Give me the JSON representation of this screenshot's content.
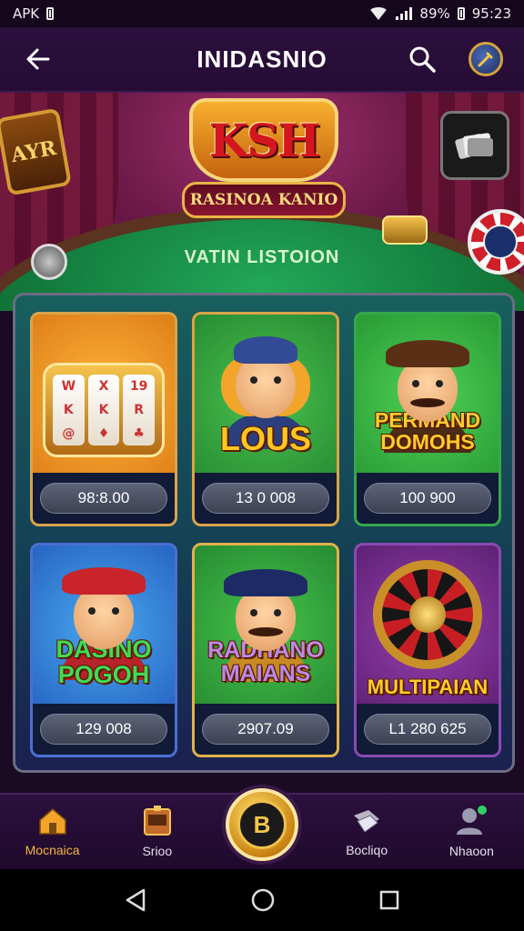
{
  "status_bar": {
    "left_text": "APK",
    "battery_text": "89%",
    "time": "95:23"
  },
  "app_bar": {
    "title": "INIDASNIO",
    "back_icon": "arrow-left-icon",
    "search_icon": "search-icon",
    "profile_icon": "avatar-icon"
  },
  "hero": {
    "logo_text": "KSH",
    "logo_ribbon": "RASINOA KANIO",
    "badge_text": "AYR",
    "table_label": "VATIN LISTOION"
  },
  "games": [
    {
      "id": "slots",
      "title": "",
      "value": "98:8.00",
      "bg": "#e88a1a",
      "art": "slot-machine"
    },
    {
      "id": "lous",
      "title": "LOUS",
      "value": "13 0 008",
      "bg": "#2e9a3a",
      "art": "character"
    },
    {
      "id": "permand",
      "title": "PERMAND DOMOHS",
      "value": "100 900",
      "bg": "#29a23a",
      "art": "character"
    },
    {
      "id": "dasino",
      "title": "DASINO POGOH",
      "value": "129 008",
      "bg": "#2b73d8",
      "art": "character"
    },
    {
      "id": "radhano",
      "title": "RADHANO MAIANS",
      "value": "2907.09",
      "bg": "#2b9a3c",
      "art": "character"
    },
    {
      "id": "multipaian",
      "title": "MULTIPAIAN",
      "value": "L1 280 625",
      "bg": "#6b2a80",
      "art": "roulette"
    }
  ],
  "bottom_nav": {
    "items": [
      {
        "label": "Mocnaica",
        "icon": "home-icon",
        "active": true
      },
      {
        "label": "Srioo",
        "icon": "slot-icon",
        "active": false
      },
      {
        "label": "B",
        "icon": "center-casino-icon",
        "active": false
      },
      {
        "label": "Bocliqo",
        "icon": "cards-icon",
        "active": false
      },
      {
        "label": "Nhaoon",
        "icon": "user-icon",
        "active": false
      }
    ]
  },
  "colors": {
    "accent_gold": "#f2b63c",
    "bar_purple": "#2c0f3d",
    "felt_green": "#22a95a"
  }
}
